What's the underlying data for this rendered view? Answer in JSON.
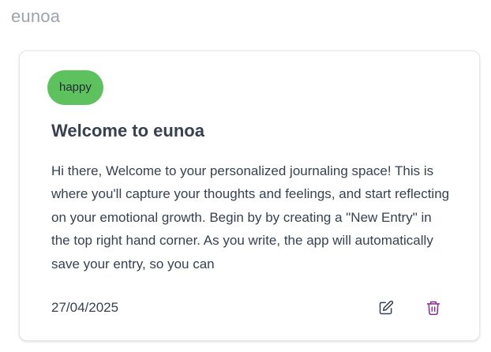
{
  "app": {
    "title": "eunoa"
  },
  "entry": {
    "mood": "happy",
    "mood_color": "#5dc25d",
    "title": "Welcome to eunoa",
    "body": "Hi there, Welcome to your personalized journaling space! This is where you'll capture your thoughts and feelings, and start reflecting on your emotional growth. Begin by by creating a \"New Entry\" in the top right hand corner. As you write, the app will automatically save your entry, so you can",
    "date": "27/04/2025",
    "actions": {
      "edit_icon": "edit-icon",
      "edit_color": "#374151",
      "delete_icon": "trash-icon",
      "delete_color": "#8b2a8f"
    }
  }
}
